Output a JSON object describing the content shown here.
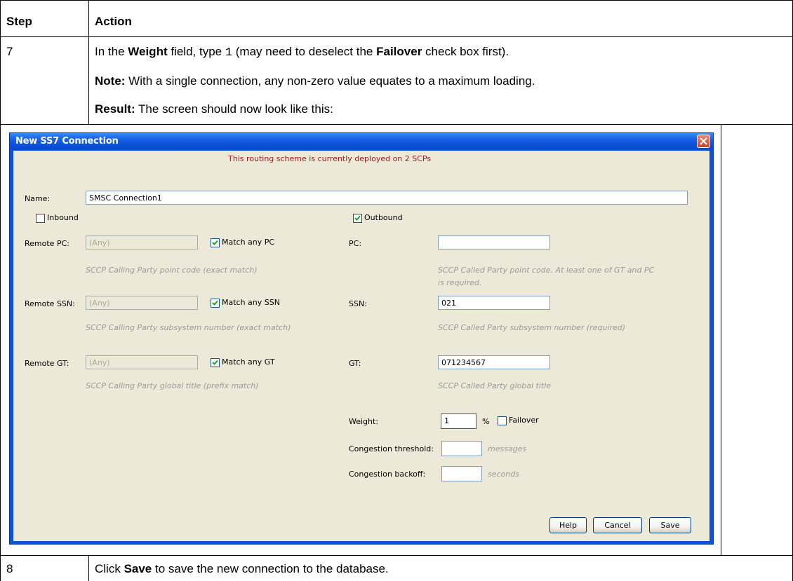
{
  "table": {
    "headers": {
      "step": "Step",
      "action": "Action"
    },
    "row7": {
      "step": "7",
      "line1": {
        "pre": "In the ",
        "bold1": "Weight",
        "mid": " field, type ",
        "code": "1",
        "mid2": " (may need to deselect the ",
        "bold2": "Failover",
        "post": " check box first)."
      },
      "line2": {
        "bold": "Note:",
        "text": " With a single connection, any non-zero value equates to a maximum loading."
      },
      "line3": {
        "bold": "Result:",
        "text": " The screen should now look like this:"
      }
    },
    "row8": {
      "step": "8",
      "pre": "Click ",
      "bold": "Save",
      "post": " to save the new connection to the database."
    }
  },
  "dialog": {
    "title": "New SS7 Connection",
    "deploy_message": "This routing scheme is currently deployed on 2 SCPs",
    "name_label": "Name:",
    "name_value": "SMSC Connection1",
    "inbound": {
      "label": "Inbound",
      "checked": false
    },
    "outbound": {
      "label": "Outbound",
      "checked": true
    },
    "left": {
      "remote_pc": {
        "label": "Remote PC:",
        "value": "(Any)",
        "match_label": "Match any PC",
        "checked": true,
        "hint": "SCCP Calling Party point code (exact match)"
      },
      "remote_ssn": {
        "label": "Remote SSN:",
        "value": "(Any)",
        "match_label": "Match any SSN",
        "checked": true,
        "hint": "SCCP Calling Party subsystem number (exact match)"
      },
      "remote_gt": {
        "label": "Remote GT:",
        "value": "(Any)",
        "match_label": "Match any GT",
        "checked": true,
        "hint": "SCCP Calling Party global title (prefix match)"
      }
    },
    "right": {
      "pc": {
        "label": "PC:",
        "value": "",
        "hint1": "SCCP Called Party point code. At least one of GT and PC",
        "hint2": "is required."
      },
      "ssn": {
        "label": "SSN:",
        "value": "021",
        "hint": "SCCP Called Party subsystem number (required)"
      },
      "gt": {
        "label": "GT:",
        "value": "071234567",
        "hint": "SCCP Called Party global title"
      },
      "weight": {
        "label": "Weight:",
        "value": "1",
        "unit": "%",
        "failover_label": "Failover",
        "failover_checked": false
      },
      "congestion_threshold": {
        "label": "Congestion threshold:",
        "value": "",
        "unit": "messages"
      },
      "congestion_backoff": {
        "label": "Congestion backoff:",
        "value": "",
        "unit": "seconds"
      }
    },
    "buttons": {
      "help": "Help",
      "cancel": "Cancel",
      "save": "Save"
    }
  }
}
